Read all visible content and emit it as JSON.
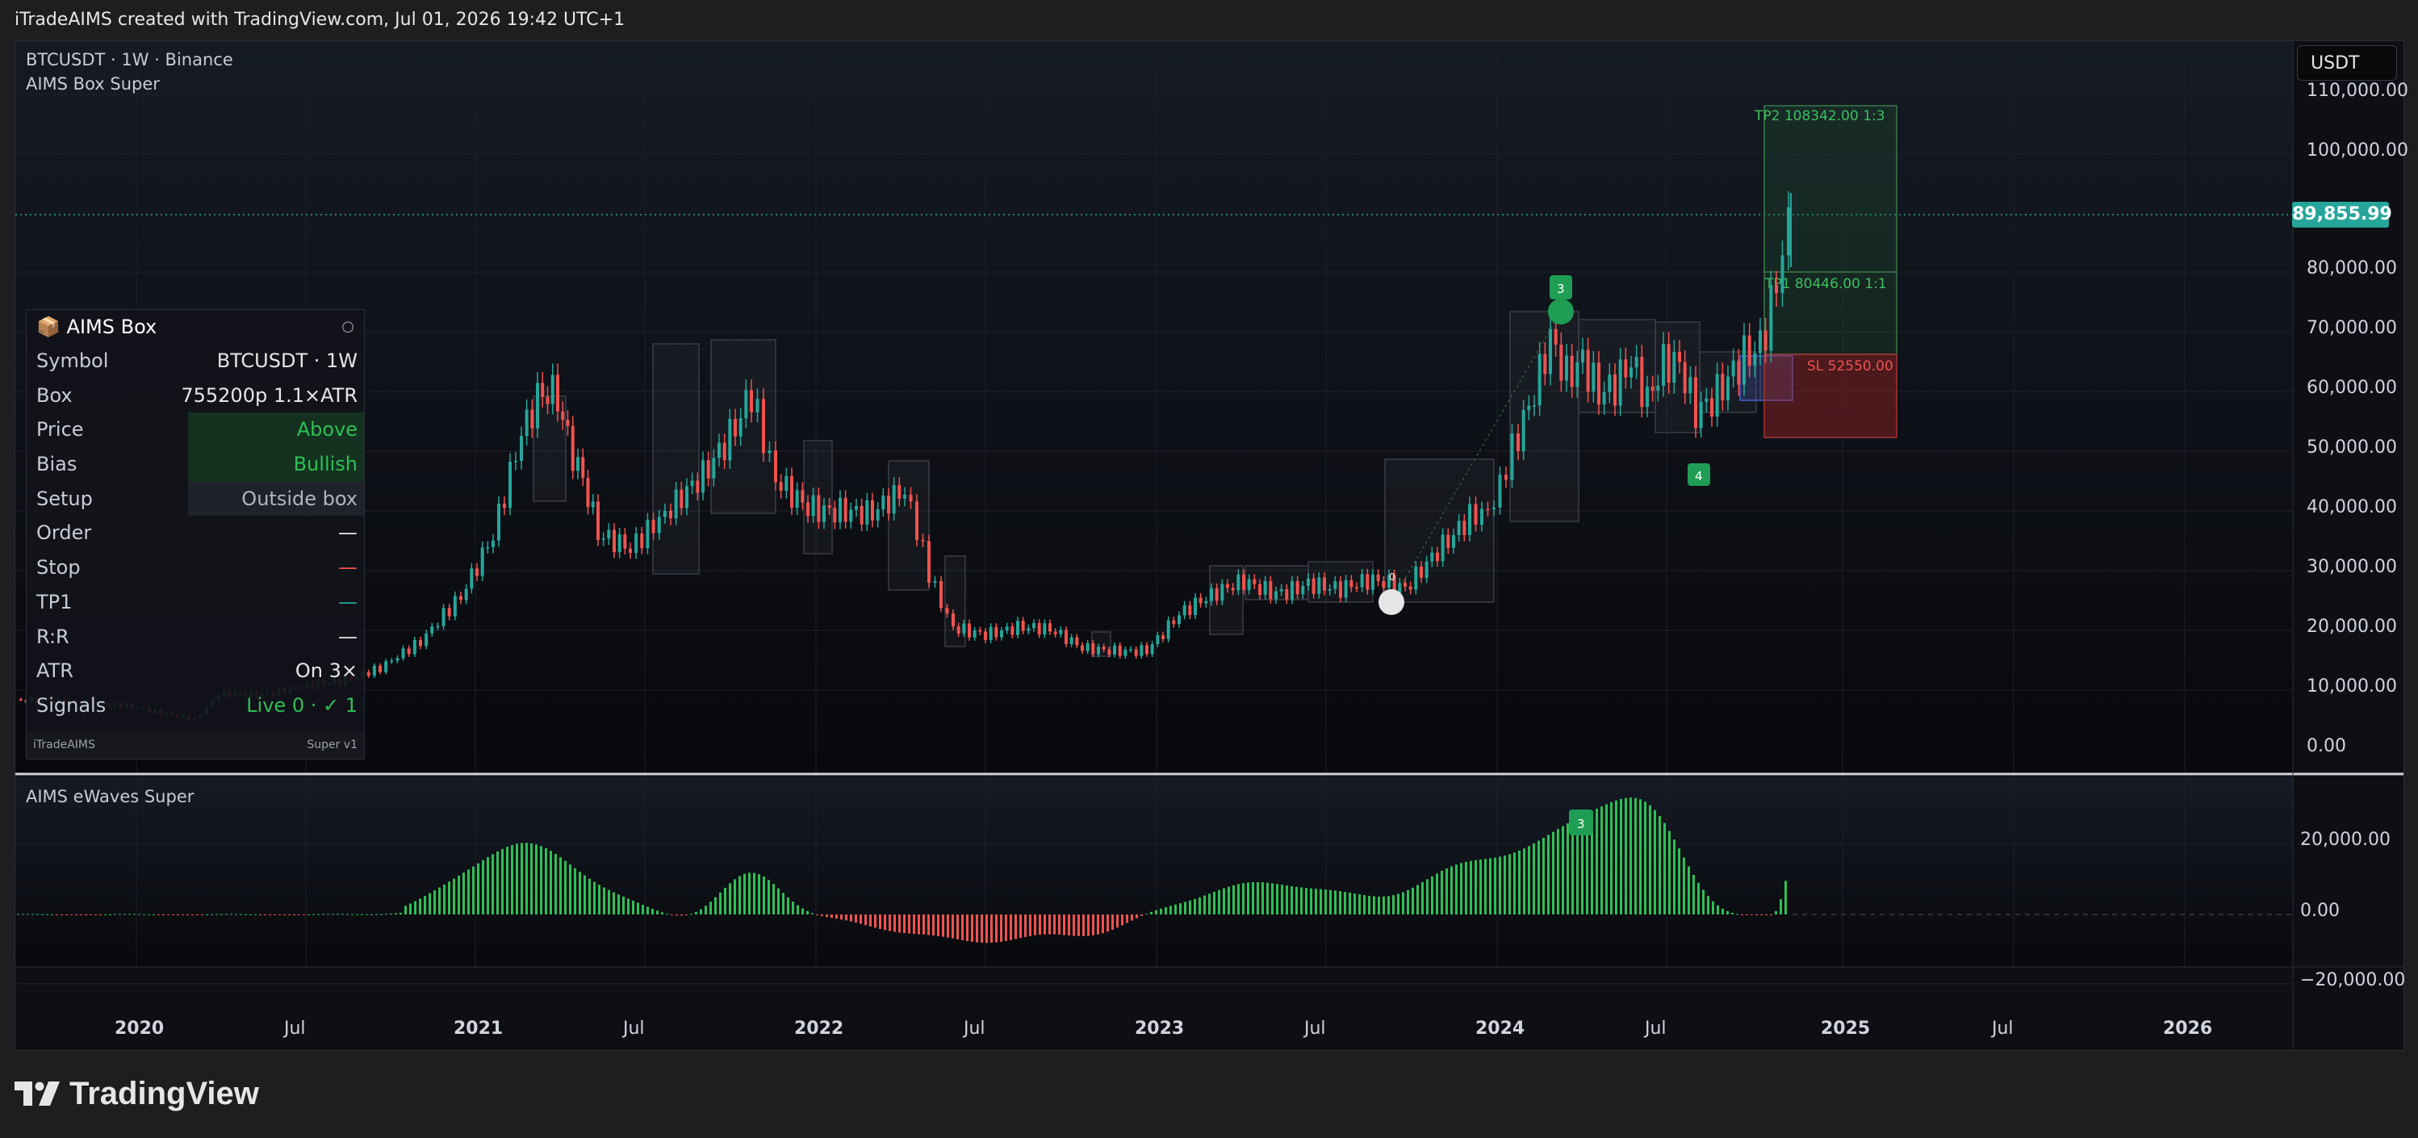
{
  "header": {
    "caption": "iTradeAIMS created with TradingView.com, Jul 01, 2026 19:42 UTC+1"
  },
  "legend": {
    "symbol_line": "BTCUSDT · 1W · Binance",
    "indicator": "AIMS Box Super",
    "subpane_title": "AIMS eWaves Super"
  },
  "currency_button": "USDT",
  "price_axis": {
    "labels": [
      "110,000.00",
      "100,000.00",
      "80,000.00",
      "70,000.00",
      "60,000.00",
      "50,000.00",
      "40,000.00",
      "30,000.00",
      "20,000.00",
      "10,000.00",
      "0.00"
    ]
  },
  "last_price": "89,855.99",
  "osc_axis": {
    "labels": [
      "20,000.00",
      "0.00",
      "−20,000.00"
    ]
  },
  "time_axis": {
    "labels": [
      "2020",
      "Jul",
      "2021",
      "Jul",
      "2022",
      "Jul",
      "2023",
      "Jul",
      "2024",
      "Jul",
      "2025",
      "Jul",
      "2026"
    ]
  },
  "trade_levels": {
    "tp2": "TP2  108342.00   1:3",
    "tp1": "TP1  80446.00   1:1",
    "sl": "SL  52550.00"
  },
  "markers": {
    "signal3": "3",
    "signal4": "4",
    "zero": "0",
    "osc3": "3"
  },
  "panel": {
    "title": "AIMS Box",
    "title_icon": "📦",
    "close_icon": "○",
    "rows": [
      {
        "k": "Symbol",
        "v": "BTCUSDT · 1W"
      },
      {
        "k": "Box",
        "v": "755200p  1.1×ATR"
      },
      {
        "k": "Price",
        "v": "Above"
      },
      {
        "k": "Bias",
        "v": "Bullish"
      },
      {
        "k": "Setup",
        "v": "Outside box"
      },
      {
        "k": "Order",
        "v": "—"
      },
      {
        "k": "Stop",
        "v": "—"
      },
      {
        "k": "TP1",
        "v": "—"
      },
      {
        "k": "R:R",
        "v": "—"
      },
      {
        "k": "ATR",
        "v": "On 3×"
      },
      {
        "k": "Signals",
        "v": "Live 0 · ✓ 1"
      }
    ],
    "footer_left": "iTradeAIMS",
    "footer_right": "Super v1"
  },
  "brand": {
    "name": "TradingView"
  },
  "colors": {
    "up": "#26a69a",
    "down": "#ef5350",
    "green_signal": "#1f9d55",
    "accent": "#2962ff"
  },
  "chart_data": {
    "type": "candlestick",
    "series": [
      {
        "name": "BTCUSDT",
        "x": [
          "2019-11",
          "2020-01",
          "2020-04",
          "2020-07",
          "2020-10",
          "2021-01",
          "2021-04",
          "2021-07",
          "2021-11",
          "2022-01",
          "2022-04",
          "2022-07",
          "2022-10",
          "2023-01",
          "2023-04",
          "2023-07",
          "2023-10",
          "2024-01",
          "2024-03",
          "2024-07",
          "2024-10",
          "2024-11"
        ],
        "values": [
          8000,
          7500,
          8000,
          9500,
          13000,
          33000,
          58000,
          33000,
          65000,
          42000,
          40000,
          20000,
          19000,
          23000,
          30000,
          30000,
          34000,
          43000,
          70000,
          62000,
          68000,
          89855.99
        ]
      }
    ],
    "oscillator": {
      "name": "AIMS eWaves Super",
      "ylim": [
        -25000,
        30000
      ]
    },
    "ylim": [
      0,
      115000
    ]
  }
}
